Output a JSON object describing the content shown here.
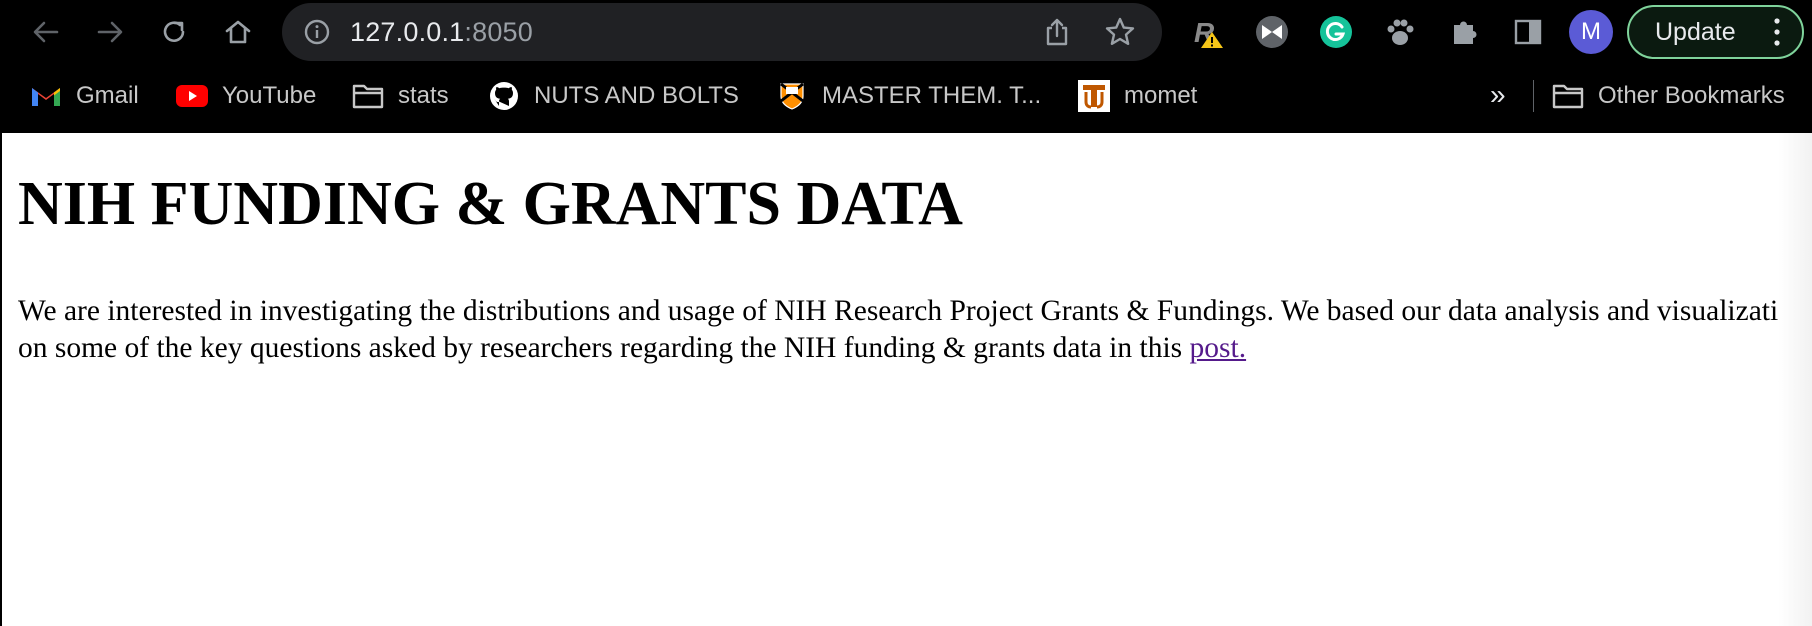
{
  "browser": {
    "url_host": "127.0.0.1",
    "url_port": ":8050",
    "profile_initial": "M",
    "update_label": "Update",
    "extensions": [
      "rhymezone-warning-icon",
      "bowtie-extension-icon",
      "grammarly-icon",
      "paw-extension-icon",
      "puzzle-extensions-icon",
      "side-panel-icon"
    ],
    "bookmarks": [
      {
        "label": "Gmail",
        "icon": "gmail-icon"
      },
      {
        "label": "YouTube",
        "icon": "youtube-icon"
      },
      {
        "label": "stats",
        "icon": "folder-icon"
      },
      {
        "label": "NUTS AND BOLTS",
        "icon": "github-icon"
      },
      {
        "label": "MASTER THEM. T...",
        "icon": "princeton-shield-icon"
      },
      {
        "label": "momet",
        "icon": "ut-logo-icon"
      }
    ],
    "bookmarks_overflow": "»",
    "other_bookmarks_label": "Other Bookmarks"
  },
  "page": {
    "heading": "NIH FUNDING & GRANTS DATA",
    "intro_text": "We are interested in investigating the distributions and usage of NIH Research Project Grants & Fundings. We based our data analysis and visualization on some of the key questions asked by researchers regarding the NIH funding & grants data in this ",
    "link_text": "post."
  },
  "colors": {
    "chrome_bg": "#000000",
    "omnibox_bg": "#202124",
    "update_border": "#7fd39b",
    "profile_bg": "#5b5bd6",
    "visited_link": "#551a8b"
  }
}
